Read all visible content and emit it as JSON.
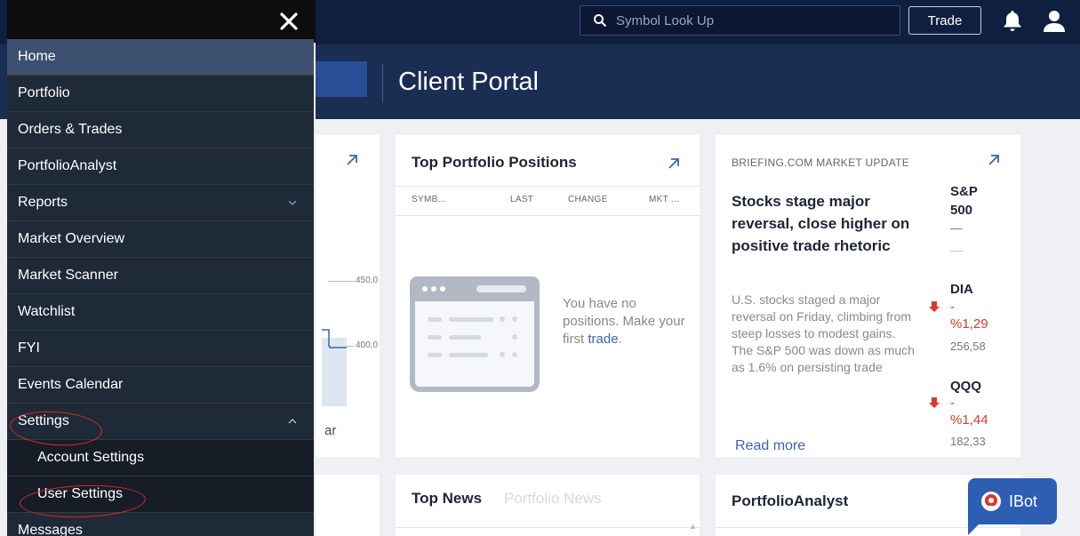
{
  "topbar": {
    "search_placeholder": "Symbol Look Up",
    "trade_label": "Trade",
    "icons": [
      "search-icon",
      "bell-icon",
      "user-icon"
    ]
  },
  "header": {
    "title": "Client Portal"
  },
  "menu": {
    "close_icon": "close-icon",
    "items": [
      {
        "label": "Home",
        "active": true
      },
      {
        "label": "Portfolio"
      },
      {
        "label": "Orders & Trades"
      },
      {
        "label": "PortfolioAnalyst"
      },
      {
        "label": "Reports",
        "chevron": "down"
      },
      {
        "label": "Market Overview"
      },
      {
        "label": "Market Scanner"
      },
      {
        "label": "Watchlist"
      },
      {
        "label": "FYI"
      },
      {
        "label": "Events Calendar"
      },
      {
        "label": "Settings",
        "chevron": "up"
      },
      {
        "label": "Account Settings",
        "sub": true
      },
      {
        "label": "User Settings",
        "sub": true
      },
      {
        "label": "Messages"
      }
    ]
  },
  "left_card": {
    "ticks": [
      "450,0",
      "400,0"
    ],
    "footer_label": "ar"
  },
  "positions": {
    "title": "Top Portfolio Positions",
    "columns": [
      "SYMB...",
      "LAST",
      "CHANGE",
      "MKT ..."
    ],
    "empty_text": "You have no positions. Make your first",
    "empty_link": "trade",
    "empty_suffix": "."
  },
  "briefing": {
    "source": "BRIEFING.COM MARKET UPDATE",
    "headline": "Stocks stage major reversal, close higher on positive trade rhetoric",
    "body": "U.S. stocks staged a major reversal on Friday, climbing from steep losses to modest gains. The S&P 500 was down as much as 1.6% on persisting trade",
    "read_more": "Read more",
    "indices": [
      {
        "name": "S&P 500",
        "change": "—",
        "price": "—"
      },
      {
        "name": "DIA",
        "change": "-\n%1,29",
        "price": "256,58"
      },
      {
        "name": "QQQ",
        "change": "-\n%1,44",
        "price": "182,33"
      }
    ],
    "colors": {
      "down": "#d9382f"
    }
  },
  "news": {
    "active_tab": "Top News",
    "inactive_tab": "Portfolio News"
  },
  "portfolio_analyst": {
    "title": "PortfolioAnalyst"
  },
  "ibot": {
    "label": "IBot"
  }
}
